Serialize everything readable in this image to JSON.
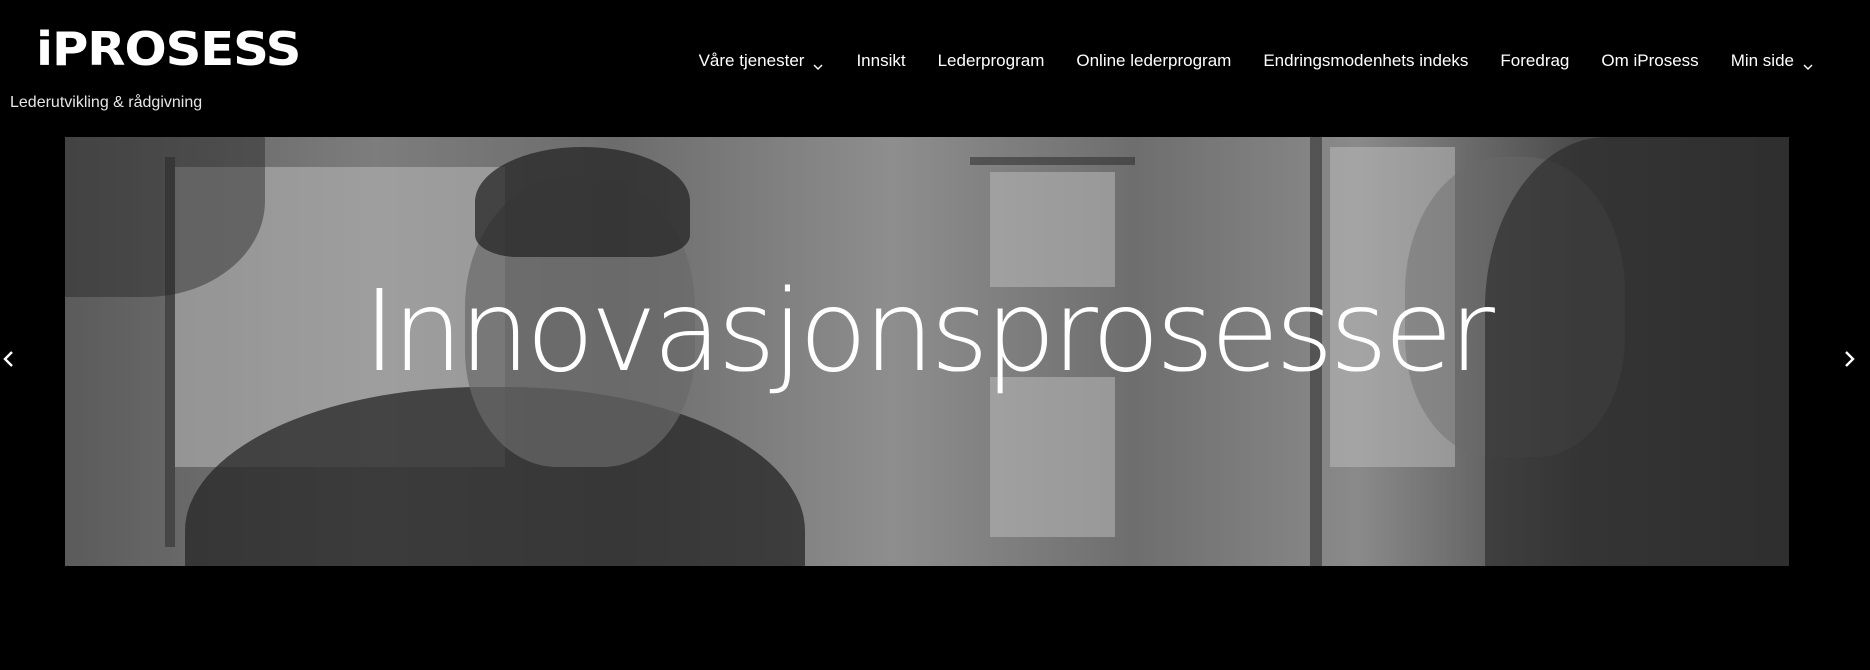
{
  "header": {
    "logo_text": "iPROSESS",
    "tagline": "Lederutvikling & rådgivning"
  },
  "nav": {
    "items": [
      {
        "label": "Våre tjenester",
        "has_dropdown": true
      },
      {
        "label": "Innsikt",
        "has_dropdown": false
      },
      {
        "label": "Lederprogram",
        "has_dropdown": false
      },
      {
        "label": "Online lederprogram",
        "has_dropdown": false
      },
      {
        "label": "Endringsmodenhets indeks",
        "has_dropdown": false
      },
      {
        "label": "Foredrag",
        "has_dropdown": false
      },
      {
        "label": "Om iProsess",
        "has_dropdown": false
      },
      {
        "label": "Min side",
        "has_dropdown": true
      }
    ]
  },
  "hero": {
    "title": "Innovasjonsprosesser",
    "image": "grayscale-photo-of-man-and-woman-in-meeting"
  },
  "slider": {
    "prev_icon": "chevron-left-icon",
    "next_icon": "chevron-right-icon"
  },
  "colors": {
    "background": "#000000",
    "text": "#ffffff"
  }
}
